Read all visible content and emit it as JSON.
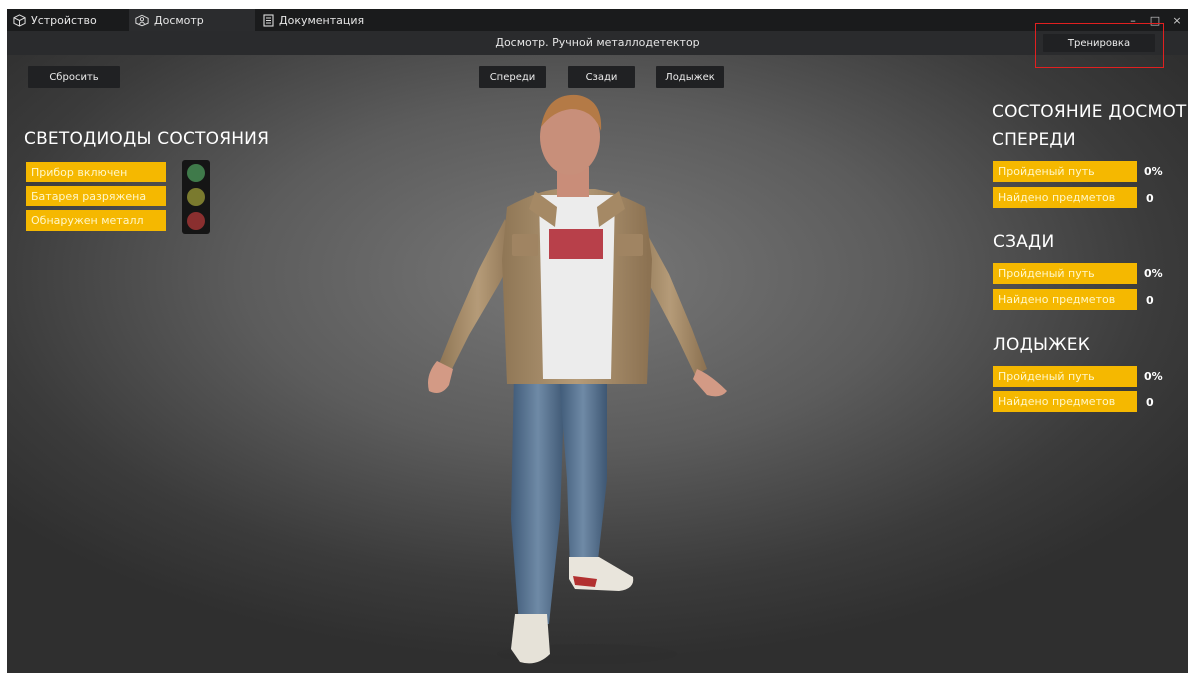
{
  "tabs": [
    {
      "label": "Устройство",
      "icon": "cube-icon",
      "active": false
    },
    {
      "label": "Досмотр",
      "icon": "person-scan-icon",
      "active": true
    },
    {
      "label": "Документация",
      "icon": "document-icon",
      "active": false
    }
  ],
  "window_controls": {
    "minimize": "–",
    "maximize": "□",
    "close": "×"
  },
  "title": "Досмотр. Ручной металлодетектор",
  "buttons": {
    "reset": "Сбросить",
    "front": "Спереди",
    "back": "Сзади",
    "ankle": "Лодыжек",
    "training": "Тренировка"
  },
  "leds": {
    "heading": "СВЕТОДИОДЫ СОСТОЯНИЯ",
    "items": [
      {
        "label": "Прибор включен",
        "color": "#3f7a4a"
      },
      {
        "label": "Батарея разряжена",
        "color": "#7a7a2e"
      },
      {
        "label": "Обнаружен металл",
        "color": "#8a2f2f"
      }
    ]
  },
  "inspection_state": {
    "heading": "СОСТОЯНИЕ ДОСМОТРА",
    "sections": [
      {
        "title": "СПЕРЕДИ",
        "path_label": "Пройденый путь",
        "path_value": "0%",
        "found_label": "Найдено предметов",
        "found_value": "0"
      },
      {
        "title": "СЗАДИ",
        "path_label": "Пройденый путь",
        "path_value": "0%",
        "found_label": "Найдено предметов",
        "found_value": "0"
      },
      {
        "title": "ЛОДЫЖЕК",
        "path_label": "Пройденый путь",
        "path_value": "0%",
        "found_label": "Найдено предметов",
        "found_value": "0"
      }
    ]
  },
  "colors": {
    "accent": "#f5b800",
    "highlight": "#e12020"
  }
}
